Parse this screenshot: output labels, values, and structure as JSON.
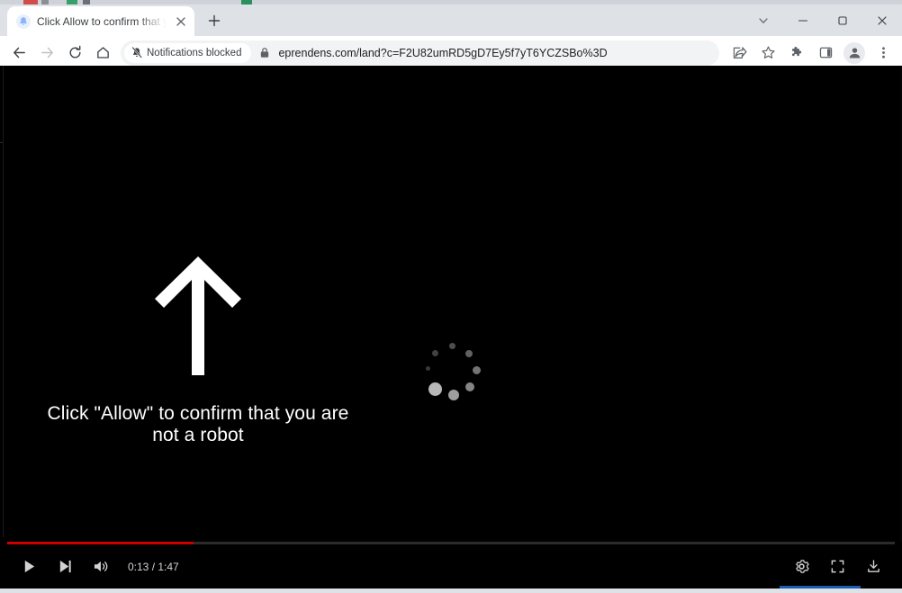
{
  "window": {
    "controls": [
      {
        "name": "tab-search",
        "icon": "chevron-down-icon",
        "label": "Search tabs"
      },
      {
        "name": "minimize",
        "icon": "minimize-icon",
        "label": "Minimize"
      },
      {
        "name": "maximize",
        "icon": "maximize-icon",
        "label": "Maximize"
      },
      {
        "name": "close",
        "icon": "close-icon",
        "label": "Close"
      }
    ]
  },
  "tabstrip": {
    "tabs": [
      {
        "title": "Click Allow to confirm that you a",
        "favicon": "bell-favicon",
        "close_label": "Close tab",
        "active": true
      }
    ],
    "new_tab_label": "New tab"
  },
  "toolbar": {
    "back_label": "Back",
    "forward_label": "Forward",
    "reload_label": "Reload",
    "home_label": "Home",
    "notifications_chip": {
      "label": "Notifications blocked",
      "icon": "bell-slash-icon"
    },
    "site_lock_icon": "lock-icon",
    "url": "eprendens.com/land?c=F2U82umRD5gD7Ey5f7yT6YCZSBo%3D",
    "url_host": "eprendens.com",
    "url_path": "/land?c=F2U82umRD5gD7Ey5f7yT6YCZSBo%3D",
    "right_icons": [
      {
        "name": "share-button",
        "icon": "share-icon",
        "label": "Share this page"
      },
      {
        "name": "bookmark-button",
        "icon": "star-icon",
        "label": "Bookmark this tab"
      },
      {
        "name": "extensions-button",
        "icon": "puzzle-icon",
        "label": "Extensions"
      },
      {
        "name": "side-panel-button",
        "icon": "side-panel-icon",
        "label": "Side panel"
      },
      {
        "name": "profile-button",
        "icon": "avatar-icon",
        "label": "Profile"
      },
      {
        "name": "chrome-menu-button",
        "icon": "three-dots-icon",
        "label": "Customize and control Google Chrome"
      }
    ]
  },
  "page": {
    "background_color": "#000000",
    "arrow_icon": "arrow-up-icon",
    "headline": "Click \"Allow\" to confirm that you are not a robot",
    "spinner": {
      "name": "loading-spinner",
      "dots": 8
    }
  },
  "player": {
    "progress_percent": 21,
    "progress_color": "#cc0000",
    "time_display": "0:13 / 1:47",
    "current_time": "0:13",
    "duration": "1:47",
    "left_controls": [
      {
        "name": "play-button",
        "icon": "play-icon",
        "label": "Play"
      },
      {
        "name": "next-button",
        "icon": "next-track-icon",
        "label": "Next"
      },
      {
        "name": "volume-button",
        "icon": "volume-icon",
        "label": "Mute"
      }
    ],
    "right_controls": [
      {
        "name": "settings-button",
        "icon": "gear-icon",
        "label": "Settings"
      },
      {
        "name": "fullscreen-button",
        "icon": "fullscreen-icon",
        "label": "Full screen"
      },
      {
        "name": "download-button",
        "icon": "download-icon",
        "label": "Download"
      }
    ]
  }
}
